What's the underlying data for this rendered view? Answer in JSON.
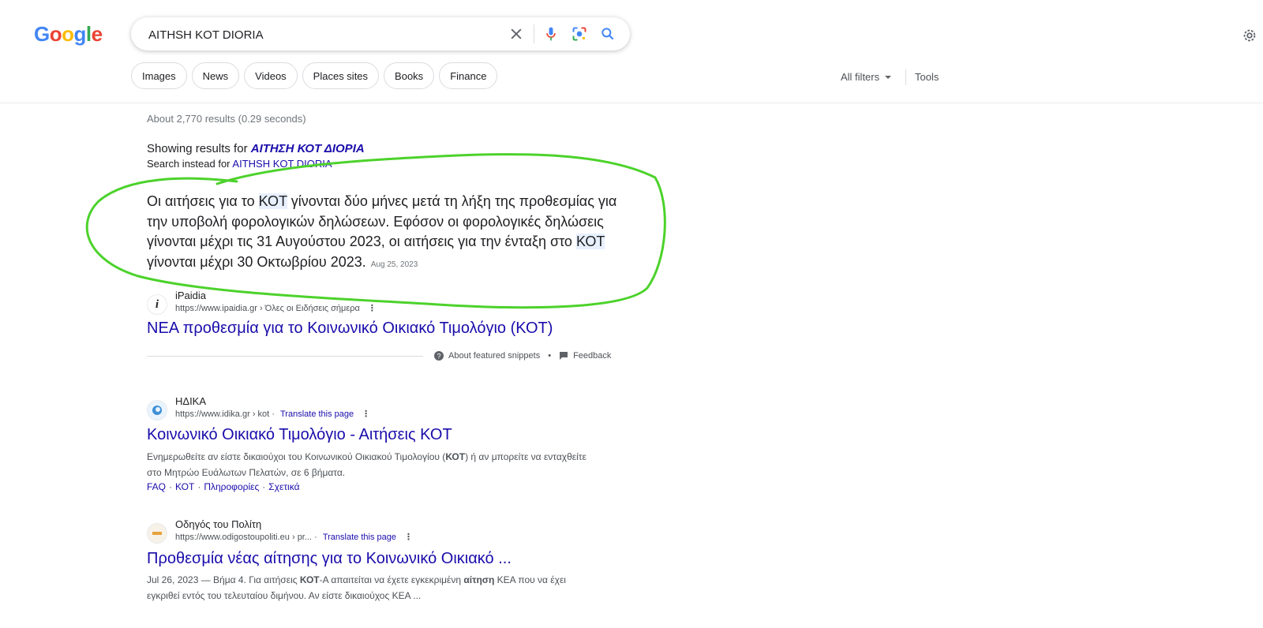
{
  "logo": {
    "letters": [
      "G",
      "o",
      "o",
      "g",
      "l",
      "e"
    ],
    "colors": [
      "#4285F4",
      "#EA4335",
      "#FBBC05",
      "#4285F4",
      "#34A853",
      "#EA4335"
    ]
  },
  "search": {
    "query": "AITHSH KOT DIORIA"
  },
  "chips": [
    "Images",
    "News",
    "Videos",
    "Places sites",
    "Books",
    "Finance"
  ],
  "filters": {
    "all_filters": "All filters",
    "tools": "Tools"
  },
  "stats": "About 2,770 results (0.29 seconds)",
  "correction": {
    "showing_prefix": "Showing results for ",
    "corrected": "ΑΙΤΗΣΗ ΚΟΤ ΔΙΟΡΙΑ",
    "instead_prefix": "Search instead for ",
    "original": "AITHSH KOT DIORIA"
  },
  "featured": {
    "seg1": "Οι αιτήσεις για το ",
    "hl1": "ΚΟΤ",
    "seg2": " γίνονται δύο μήνες μετά τη λήξη της προθεσμίας για την υποβολή φορολογικών δηλώσεων. Εφόσον οι φορολογικές δηλώσεις γίνονται μέχρι τις 31 Αυγούστου 2023, οι αιτήσεις για την ένταξη στο ",
    "hl2": "ΚΟΤ",
    "seg3": " γίνονται μέχρι 30 Οκτωβρίου 2023.",
    "date": "Aug 25, 2023",
    "site": "iPaidia",
    "url": "https://www.ipaidia.gr › Όλες οι Ειδήσεις σήμερα",
    "title": "ΝΕΑ προθεσμία για το Κοινωνικό Οικιακό Τιμολόγιο (ΚΟΤ)",
    "about": "About featured snippets",
    "feedback": "Feedback"
  },
  "results": [
    {
      "site": "ΗΔΙΚΑ",
      "url": "https://www.idika.gr › kot",
      "translate": "Translate this page",
      "title": "Κοινωνικό Οικιακό Τιμολόγιο - Αιτήσεις ΚΟΤ",
      "desc_a": "Ενημερωθείτε αν είστε δικαιούχοι του Κοινωνικού Οικιακού Τιμολογίου (",
      "desc_b": "ΚΟΤ",
      "desc_c": ") ή αν μπορείτε να ενταχθείτε στο Μητρώο Ευάλωτων Πελατών, σε 6 βήματα.",
      "sitelinks": [
        "FAQ",
        "ΚΟΤ",
        "Πληροφορίες",
        "Σχετικά"
      ]
    },
    {
      "site": "Οδηγός του Πολίτη",
      "url": "https://www.odigostoupoliti.eu › pr...",
      "translate": "Translate this page",
      "title": "Προθεσμία νέας αίτησης για το Κοινωνικό Οικιακό ...",
      "desc_a": "Jul 26, 2023 — Βήμα 4. Για αιτήσεις ",
      "desc_b": "ΚΟΤ",
      "desc_c": "-Α απαιτείται να έχετε εγκεκριμένη ",
      "desc_d": "αίτηση",
      "desc_e": " ΚΕΑ που να έχει εγκριθεί εντός του τελευταίου διμήνου. Αν είστε δικαιούχος ΚΕΑ ..."
    }
  ]
}
